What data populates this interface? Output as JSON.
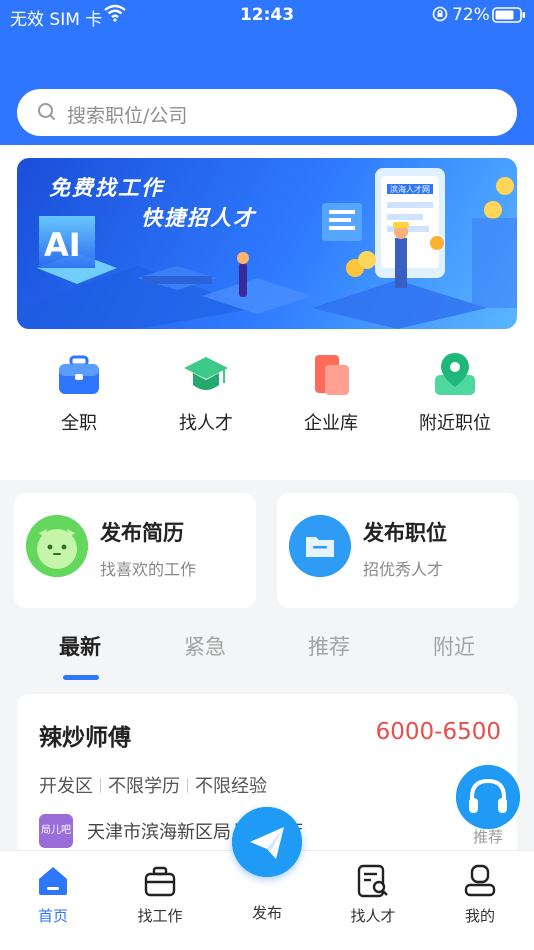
{
  "status_bar": {
    "carrier": "无效 SIM 卡",
    "time": "12:43",
    "battery": "72%"
  },
  "search": {
    "placeholder": "搜索职位/公司"
  },
  "banner": {
    "headline_1": "免费找工作",
    "headline_2": "快捷招人才",
    "sign_text": "滨海人才网"
  },
  "categories": [
    {
      "label": "全职",
      "icon": "briefcase-icon"
    },
    {
      "label": "找人才",
      "icon": "graduation-cap-icon"
    },
    {
      "label": "企业库",
      "icon": "company-folder-icon"
    },
    {
      "label": "附近职位",
      "icon": "location-pin-icon"
    }
  ],
  "publish": {
    "resume": {
      "title": "发布简历",
      "subtitle": "找喜欢的工作"
    },
    "job": {
      "title": "发布职位",
      "subtitle": "招优秀人才"
    }
  },
  "tabs": [
    "最新",
    "紧急",
    "推荐",
    "附近"
  ],
  "active_tab": "最新",
  "job_card": {
    "title": "辣炒师傅",
    "salary": "6000-6500",
    "tags": [
      "开发区",
      "不限学历",
      "不限经验"
    ],
    "company_logo_text": "局儿吧",
    "address": "天津市滨海新区局儿吧餐厅"
  },
  "float_button": {
    "label": "推荐",
    "icon": "headset-icon"
  },
  "tabbar": {
    "home": "首页",
    "find_job": "找工作",
    "publish": "发布",
    "find_talent": "找人才",
    "mine": "我的"
  },
  "colors": {
    "brand": "#2f76ff",
    "salary": "#e94d4d",
    "fab": "#1f9bf5"
  }
}
